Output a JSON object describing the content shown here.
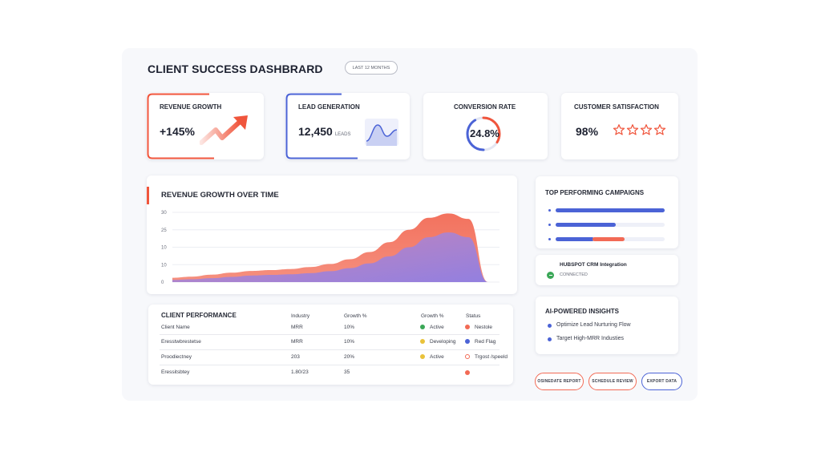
{
  "header": {
    "title": "CLIENT SUCCESS DASHBRARD",
    "period_label": "LAST 12 MONTHS"
  },
  "kpis": [
    {
      "label": "REVENUE GROWTH",
      "value": "+145%",
      "icon": "trend-up-arrow-icon",
      "accent": "#f0553c"
    },
    {
      "label": "LEAD GENERATION",
      "value": "12,450",
      "unit": "LEADS",
      "icon": "sparkline-icon",
      "accent": "#4b63d6"
    },
    {
      "label": "CONVERSION RATE",
      "value": "24.8%",
      "icon": "progress-ring-icon",
      "progress": 0.75
    },
    {
      "label": "CUSTOMER SATISFACTION",
      "value": "98%",
      "icon": "star-icon",
      "stars": 4
    }
  ],
  "revenue_chart": {
    "title": "REVENUE GROWTH OVER TIME",
    "y_ticks": [
      "30",
      "25",
      "10",
      "10",
      "0"
    ],
    "colors": {
      "front": "#a07ad8",
      "back": "#f26a55"
    }
  },
  "chart_data": {
    "type": "area",
    "title": "REVENUE GROWTH OVER TIME",
    "y_tick_labels": [
      "30",
      "25",
      "10",
      "10",
      "0"
    ],
    "series": [
      {
        "values": [
          2.0,
          2.5,
          3.4,
          4.3,
          5.1,
          5.5,
          6.0,
          6.9,
          8.3,
          10.5,
          13.8,
          18.3,
          24.0,
          29.5,
          31.5,
          29.0,
          0
        ]
      },
      {
        "values": [
          1.0,
          1.3,
          1.8,
          2.4,
          3.0,
          3.3,
          3.6,
          4.1,
          5.0,
          6.4,
          8.6,
          11.8,
          16.0,
          20.6,
          22.8,
          20.6,
          0
        ]
      }
    ]
  },
  "campaigns": {
    "title": "TOP PERFORMING CAMPAIGNS",
    "items": [
      {
        "fill": 1.0,
        "color": "#4b63d6",
        "fill2": 0.0
      },
      {
        "fill": 0.55,
        "color": "#4b63d6",
        "fill2": 0.0
      },
      {
        "fill": 0.35,
        "color": "#4b63d6",
        "fill2": 0.3,
        "color2": "#f26a55"
      }
    ]
  },
  "integration": {
    "title": "HUBSPOT CRM Integration",
    "status": "CONNECTED",
    "status_color": "#3aa757"
  },
  "insights": {
    "title": "AI-POWERED INSIGHTS",
    "items": [
      "Optimize Lead Nurturing Flow",
      "Target High-MRR Industies"
    ],
    "bullet_color": "#4b63d6"
  },
  "table": {
    "title": "CLIENT PERFORMANCE",
    "columns": [
      "Industry",
      "Growth %",
      "Growth %",
      "Status"
    ],
    "rows": [
      {
        "name": "Client Name",
        "industry": "MRR",
        "growth": "10%",
        "stage": "Active",
        "stage_color": "#3aa757",
        "status": "Nestole",
        "status_color": "#f26a55"
      },
      {
        "name": "Eresstwbrestetse",
        "industry": "MRR",
        "growth": "10%",
        "stage": "Developing",
        "stage_color": "#e9c23a",
        "status": "Red Flag",
        "status_color": "#4b63d6"
      },
      {
        "name": "Proodiectney",
        "industry": "203",
        "growth": "20%",
        "stage": "Active",
        "stage_color": "#e9c23a",
        "status": "Trgost /speeld",
        "status_color": "#f26a55",
        "status_ring": true
      },
      {
        "name": "Eressitsbtey",
        "industry": "1.80/23",
        "growth": "35",
        "stage": "",
        "stage_color": "",
        "status": "",
        "status_color": "#f26a55"
      }
    ]
  },
  "actions": [
    {
      "label": "OSINEDATE REPORT",
      "color": "#f26a55"
    },
    {
      "label": "SCHEDULE REVIEW",
      "color": "#f26a55"
    },
    {
      "label": "EXPORT DATA",
      "color": "#4b63d6"
    }
  ]
}
